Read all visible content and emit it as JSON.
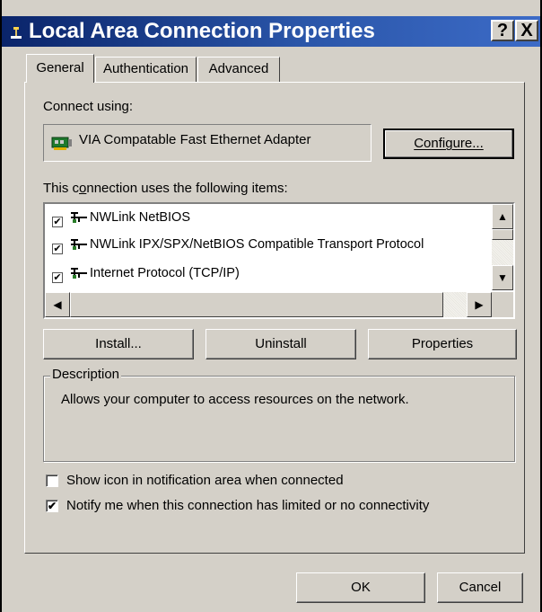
{
  "window": {
    "title": "Local Area Connection Properties",
    "help_label": "?",
    "close_label": "X"
  },
  "tabs": [
    {
      "label": "General",
      "selected": true
    },
    {
      "label": "Authentication",
      "selected": false
    },
    {
      "label": "Advanced",
      "selected": false
    }
  ],
  "general": {
    "connect_using_label": "Connect using:",
    "adapter_name": "VIA Compatable Fast Ethernet Adapter",
    "configure_label": "Configure...",
    "items_label_pre": "This c",
    "items_label_mn": "o",
    "items_label_post": "nnection uses the following items:",
    "items": [
      {
        "label": "NWLink NetBIOS",
        "checked": true
      },
      {
        "label": "NWLink IPX/SPX/NetBIOS Compatible Transport Protocol",
        "checked": true
      },
      {
        "label": "Internet Protocol (TCP/IP)",
        "checked": true
      }
    ],
    "install_label": "Install...",
    "uninstall_label": "Uninstall",
    "properties_label": "Properties",
    "description_title": "Description",
    "description_text": "Allows your computer to access resources on the network.",
    "show_icon_label": "Show icon in notification area when connected",
    "show_icon_checked": false,
    "notify_label": "Notify me when this connection has limited or no connectivity",
    "notify_checked": true
  },
  "footer": {
    "ok_label": "OK",
    "cancel_label": "Cancel"
  }
}
